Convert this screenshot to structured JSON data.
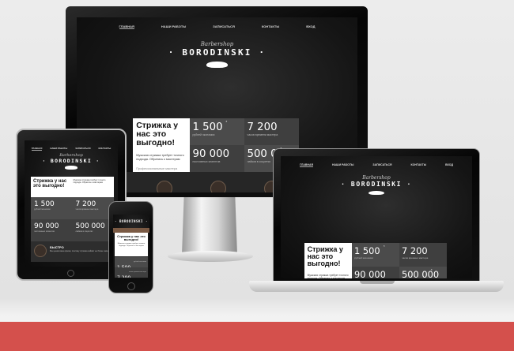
{
  "site": {
    "nav": [
      "ГЛАВНАЯ",
      "НАШИ РАБОТЫ",
      "ЗАПИСАТЬСЯ",
      "КОНТАКТЫ",
      "ВХОД"
    ],
    "brand_script": "Barbershop",
    "brand": "· BORODINSKI ·",
    "headline": "Стрижка у нас это выгодно!",
    "paragraph": "Мужская стрижка требует точного подхода. Обратись к мастерам",
    "link": "Профессиональные мастера",
    "stats": [
      {
        "value": "1 500",
        "sup": "*",
        "label": "рублей экономии"
      },
      {
        "value": "7 200",
        "sup": "",
        "label": "часов времени мастера"
      },
      {
        "value": "90 000",
        "sup": "",
        "label": "постоянных клиентов"
      },
      {
        "value": "500 000",
        "sup": "*",
        "label": "лайков в соцсетях"
      }
    ],
    "feature_title": "БЫСТРО",
    "feature_text": "Мы ценим ваше время, поэтому стрижка займёт не более часа"
  },
  "colors": {
    "accent_band": "#d4504c",
    "stat_dark": "#3f3f3f",
    "stat_mid": "#4b4b4b"
  }
}
